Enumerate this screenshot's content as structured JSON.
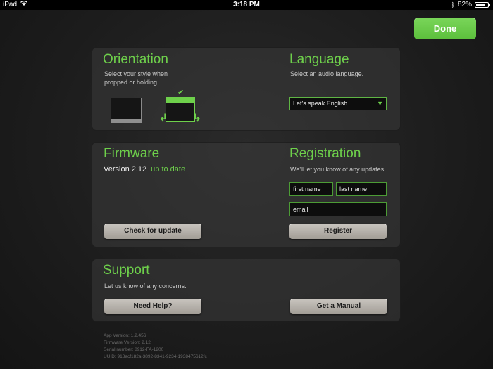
{
  "status_bar": {
    "device": "iPad",
    "time": "3:18 PM",
    "battery": "82%",
    "battery_level": 0.82
  },
  "header": {
    "done_label": "Done"
  },
  "orientation": {
    "title": "Orientation",
    "subtitle_line1": "Select your style when",
    "subtitle_line2": "propped or holding.",
    "check_glyph": "✔"
  },
  "language": {
    "title": "Language",
    "subtitle": "Select an audio language.",
    "selected": "Let's speak English"
  },
  "firmware": {
    "title": "Firmware",
    "version": "Version 2.12",
    "status": "up to date",
    "check_button": "Check for update"
  },
  "registration": {
    "title": "Registration",
    "subtitle": "We'll let you know of any updates.",
    "first_name_placeholder": "first name",
    "last_name_placeholder": "last name",
    "email_placeholder": "email",
    "register_button": "Register"
  },
  "support": {
    "title": "Support",
    "subtitle": "Let us know of any concerns.",
    "help_button": "Need Help?",
    "manual_button": "Get a Manual"
  },
  "app_info": {
    "app_version": "App Version: 1.2.456",
    "firmware_version": "Firmware Version: 2.12",
    "serial_number": "Serial number: 8912-FA-1200",
    "uuid": "UUID: 918acf182a-3892-8341-9234-1938475612fc"
  },
  "colors": {
    "accent": "#6ed04b",
    "done": "#5cbf3c",
    "button": "#b5b0aa"
  },
  "icons": {
    "wifi": "wifi-icon",
    "bluetooth": "bluetooth-icon",
    "battery": "battery-icon",
    "dropdown": "triangle-down"
  }
}
